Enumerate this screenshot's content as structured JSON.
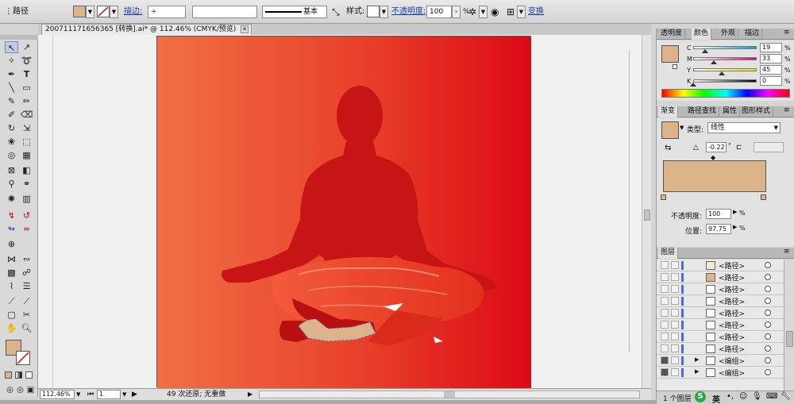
{
  "control_bar": {
    "object_type": "路径",
    "stroke_label": "描边:",
    "stroke_style": "基本",
    "style_label": "样式:",
    "opacity_label": "不透明度:",
    "opacity_value": "100",
    "opacity_unit": "%",
    "transform_label": "变换",
    "fill_color": "#dcb38a"
  },
  "document": {
    "tab_title": "200711171656365 [转换].ai* @ 112.46% (CMYK/预览)",
    "close_glyph": "✕"
  },
  "status_bar": {
    "zoom": "112.46%",
    "page": "1",
    "undo_status": "49 次还原; 无重做",
    "play_glyph": "▶"
  },
  "panels": {
    "color_panel": {
      "tabs": [
        "透明度",
        "颜色",
        "外观",
        "描边"
      ],
      "active_tab": "颜色",
      "channels": [
        {
          "label": "C",
          "value": "19",
          "fraction": 0.19
        },
        {
          "label": "M",
          "value": "33",
          "fraction": 0.33
        },
        {
          "label": "Y",
          "value": "45",
          "fraction": 0.45
        },
        {
          "label": "K",
          "value": "0",
          "fraction": 0.0
        }
      ],
      "swatch": "#dcb38a"
    },
    "gradient_panel": {
      "tabs": [
        "渐变",
        "路径查找",
        "属性",
        "图形样式"
      ],
      "active_tab": "渐变",
      "type_label": "类型:",
      "type_value": "线性",
      "angle_value": "-0.22",
      "angle_unit": "°",
      "opacity_label": "不透明度:",
      "opacity_value": "100",
      "location_label": "位置:",
      "location_value": "97.75",
      "pct": "%",
      "gradient_color": "#dcb38a"
    },
    "layers_panel": {
      "title": "图层",
      "rows": [
        {
          "name": "<路径>"
        },
        {
          "name": "<路径>"
        },
        {
          "name": "<路径>"
        },
        {
          "name": "<路径>"
        },
        {
          "name": "<路径>"
        },
        {
          "name": "<路径>"
        },
        {
          "name": "<路径>"
        },
        {
          "name": "<路径>"
        },
        {
          "name": "<编组>"
        },
        {
          "name": "<编组>"
        }
      ],
      "footer": "1 个图层"
    }
  },
  "ime_bar": {
    "logo": "S",
    "lang": "英"
  },
  "colors": {
    "accent_blue": "#4a6ed8",
    "figure_red": "#c81414",
    "bg_left": "#f07045",
    "bg_right": "#dc0a16"
  }
}
